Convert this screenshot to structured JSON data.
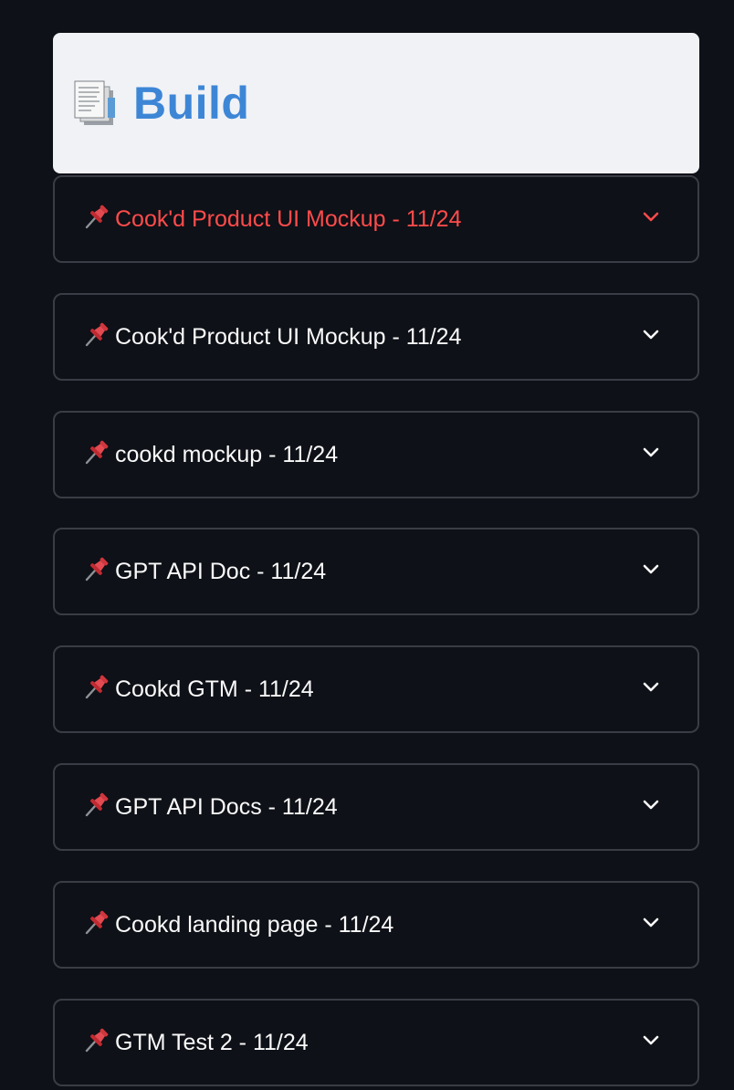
{
  "header": {
    "icon": "document-icon",
    "title": "Build"
  },
  "expanders": [
    {
      "label": "Cook'd Product UI Mockup - 11/24",
      "icon": "pushpin-icon",
      "active": true
    },
    {
      "label": "Cook'd Product UI Mockup - 11/24",
      "icon": "pushpin-icon",
      "active": false
    },
    {
      "label": "cookd mockup - 11/24",
      "icon": "pushpin-icon",
      "active": false
    },
    {
      "label": "GPT API Doc - 11/24",
      "icon": "pushpin-icon",
      "active": false
    },
    {
      "label": "Cookd GTM - 11/24",
      "icon": "pushpin-icon",
      "active": false
    },
    {
      "label": "GPT API Docs - 11/24",
      "icon": "pushpin-icon",
      "active": false
    },
    {
      "label": "Cookd landing page - 11/24",
      "icon": "pushpin-icon",
      "active": false
    },
    {
      "label": "GTM Test 2 - 11/24",
      "icon": "pushpin-icon",
      "active": false
    }
  ],
  "colors": {
    "background": "#0e1117",
    "header_bg": "#f0f2f6",
    "title": "#3d86d6",
    "active_label": "#ff4b4b",
    "label": "#fafafa",
    "border": "#3a3d45"
  }
}
